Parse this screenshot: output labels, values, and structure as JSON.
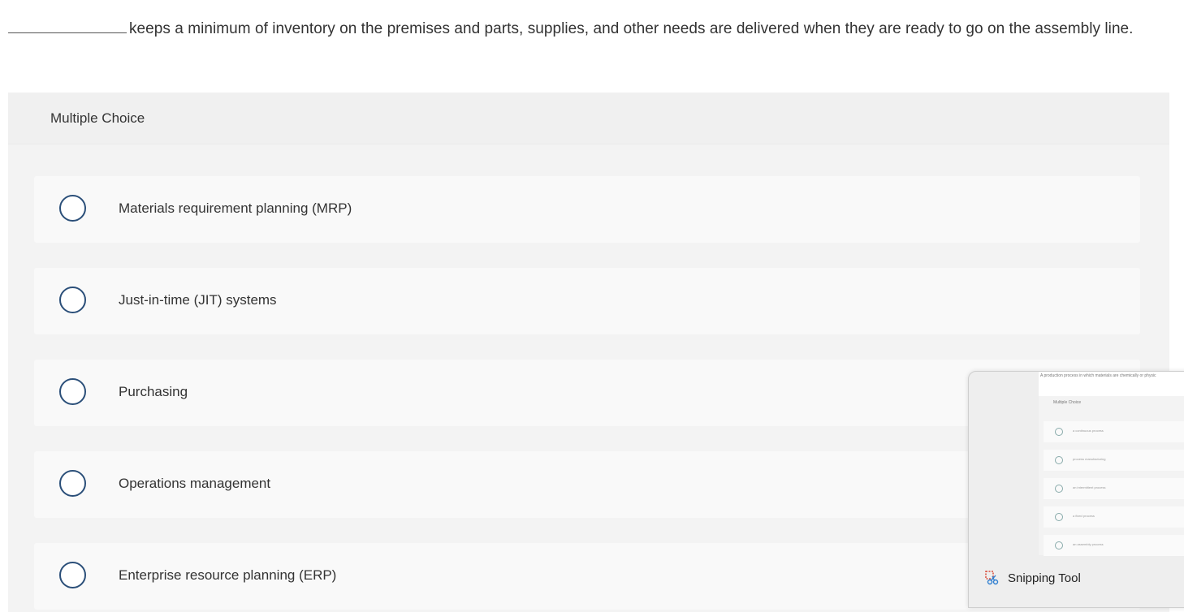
{
  "question": {
    "text": "keeps a minimum of inventory on the premises and parts, supplies, and other needs are delivered when they are ready to go on the assembly line."
  },
  "panel": {
    "title": "Multiple Choice",
    "options": [
      {
        "label": "Materials requirement planning (MRP)"
      },
      {
        "label": "Just-in-time (JIT) systems"
      },
      {
        "label": "Purchasing"
      },
      {
        "label": "Operations management"
      },
      {
        "label": "Enterprise resource planning (ERP)"
      }
    ]
  },
  "snipping_tool": {
    "label": "Snipping Tool",
    "thumbnail": {
      "question": "A production process in which materials are chemically or physic",
      "title": "Multiple Choice",
      "options": [
        "a continuous process",
        "process manufacturing",
        "an intermittent process",
        "a fixed process",
        "an assembly process"
      ]
    }
  },
  "colors": {
    "radio_border": "#2b4f79",
    "panel_bg": "#f3f3f3",
    "option_bg": "#f9f9f9"
  }
}
